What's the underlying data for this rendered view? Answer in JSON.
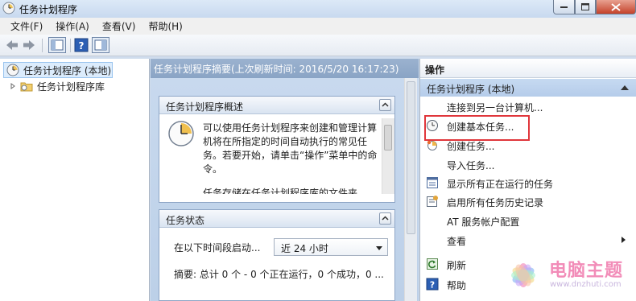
{
  "window": {
    "title": "任务计划程序"
  },
  "menubar": [
    {
      "label": "文件(F)"
    },
    {
      "label": "操作(A)"
    },
    {
      "label": "查看(V)"
    },
    {
      "label": "帮助(H)"
    }
  ],
  "tree": {
    "root": "任务计划程序 (本地)",
    "child": "任务计划程序库"
  },
  "summary": {
    "header": "任务计划程序摘要(上次刷新时间: 2016/5/20 16:17:23)",
    "overview_title": "任务计划程序概述",
    "overview_text": "可以使用任务计划程序来创建和管理计算机将在所指定的时间自动执行的常见任务。若要开始，请单击“操作”菜单中的命令。",
    "overview_cut": "任务存储在任务计划程序库的文件夹",
    "status_title": "任务状态",
    "status_label": "在以下时间段启动...",
    "status_range": "近 24 小时",
    "status_summary": "摘要: 总计 0 个 - 0 个正在运行，0 个成功，0 ..."
  },
  "actions": {
    "title": "操作",
    "group": "任务计划程序 (本地)",
    "items": [
      {
        "label": "连接到另一台计算机...",
        "icon": "none"
      },
      {
        "label": "创建基本任务...",
        "icon": "clock-wizard-icon"
      },
      {
        "label": "创建任务...",
        "icon": "create-task-icon"
      },
      {
        "label": "导入任务...",
        "icon": "none"
      },
      {
        "label": "显示所有正在运行的任务",
        "icon": "running-tasks-icon"
      },
      {
        "label": "启用所有任务历史记录",
        "icon": "history-icon"
      },
      {
        "label": "AT 服务帐户配置",
        "icon": "none"
      },
      {
        "label": "查看",
        "icon": "none"
      },
      {
        "label": "刷新",
        "icon": "refresh-icon"
      },
      {
        "label": "帮助",
        "icon": "help-icon"
      }
    ]
  },
  "watermark": {
    "text": "电脑主题",
    "url": "www.dnzhuti.com"
  },
  "colors": {
    "highlight": "#e0363b",
    "selection": "#dcecfc",
    "panel_header": "#9bb2cf"
  }
}
